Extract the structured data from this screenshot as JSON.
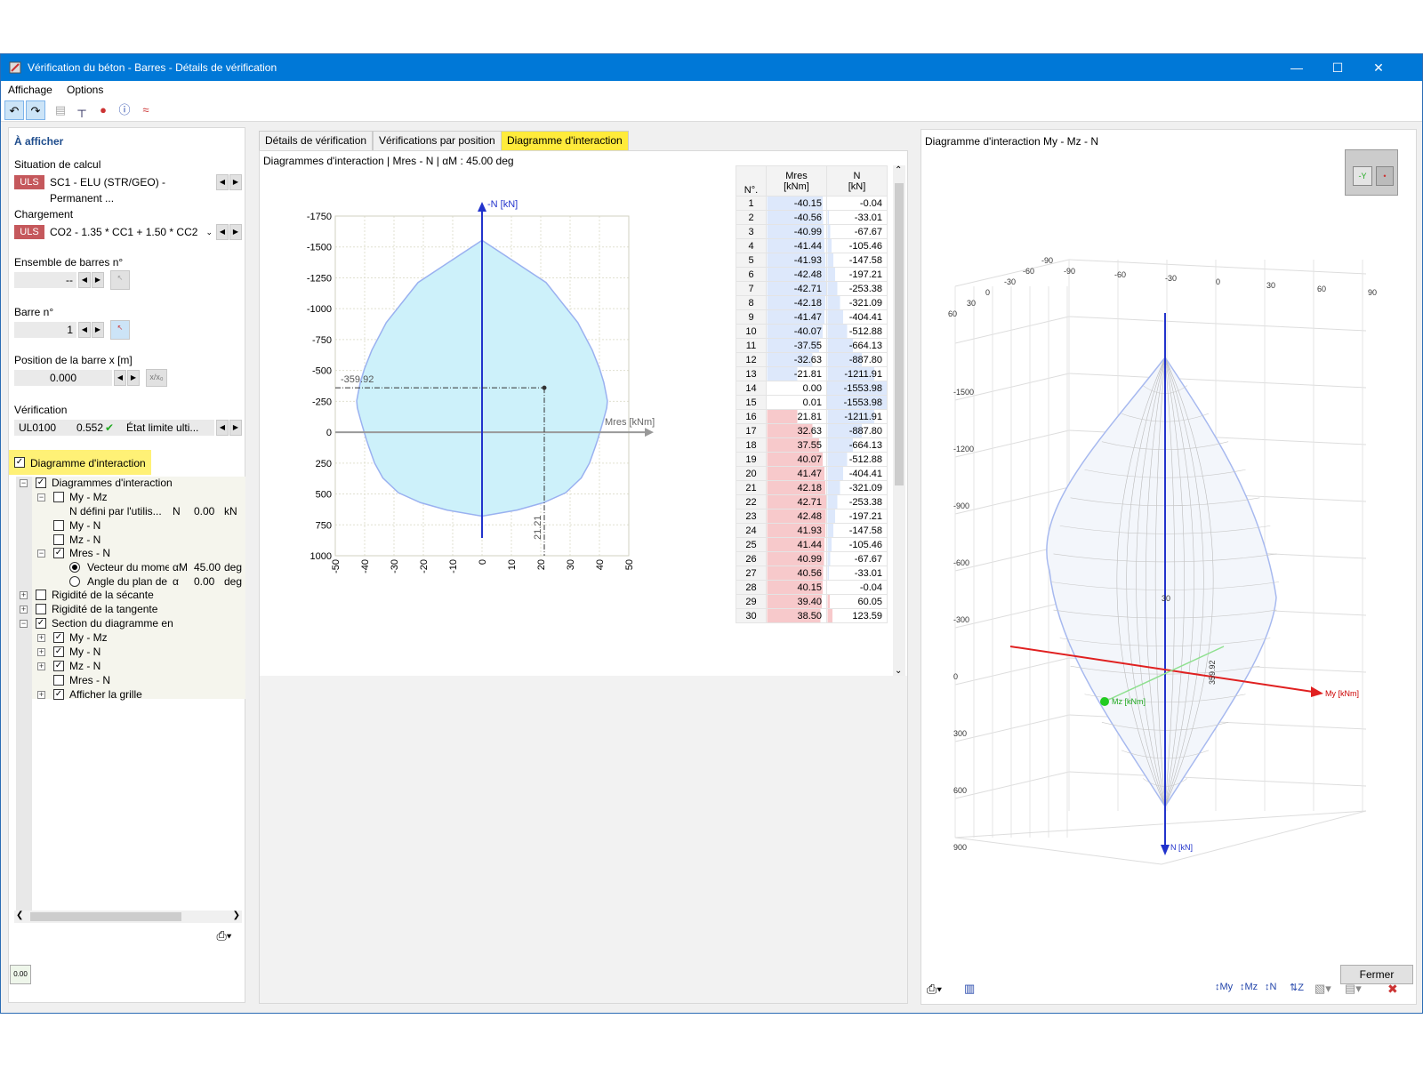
{
  "window": {
    "title": "Vérification du béton - Barres - Détails de vérification",
    "close_label": "Fermer"
  },
  "menu": [
    "Affichage",
    "Options"
  ],
  "left": {
    "header": "À afficher",
    "situation_label": "Situation de calcul",
    "situation_badge": "ULS",
    "situation_value": "SC1 - ELU (STR/GEO) - Permanent ...",
    "chargement_label": "Chargement",
    "chargement_badge": "ULS",
    "chargement_value": "CO2 - 1.35 * CC1 + 1.50 * CC2",
    "ensemble_label": "Ensemble de barres n°",
    "ensemble_value": "--",
    "barre_label": "Barre n°",
    "barre_value": "1",
    "position_label": "Position de la barre x [m]",
    "position_value": "0.000",
    "xx0": "x/x₀",
    "verif_label": "Vérification",
    "verif_code": "UL0100",
    "verif_ratio": "0.552",
    "verif_type": "État limite ulti...",
    "diag_checkbox": "Diagramme d'interaction",
    "tree": {
      "diagrammes": "Diagrammes d'interaction",
      "my_mz": "My - Mz",
      "n_defini": "N défini par l'utilis...",
      "n_sym": "N",
      "n_val": "0.00",
      "n_unit": "kN",
      "my_n": "My - N",
      "mz_n": "Mz - N",
      "mres_n": "Mres - N",
      "vecteur": "Vecteur du momer",
      "vecteur_sym": "αM",
      "vecteur_val": "45.00",
      "vecteur_unit": "deg",
      "angle": "Angle du plan de",
      "angle_sym": "α",
      "angle_val": "0.00",
      "angle_unit": "deg",
      "secante": "Rigidité de la sécante",
      "tangente": "Rigidité de la tangente",
      "section": "Section du diagramme en",
      "s_my_mz": "My - Mz",
      "s_my_n": "My - N",
      "s_mz_n": "Mz - N",
      "s_mres_n": "Mres - N",
      "grille": "Afficher la grille"
    }
  },
  "tabs": [
    "Détails de vérification",
    "Vérifications par position",
    "Diagramme d'interaction"
  ],
  "middle": {
    "subtitle": "Diagrammes d'interaction | Mres - N | αM : 45.00 deg",
    "y_axis_label": "-N [kN]",
    "x_axis_label": "Mres [kNm]",
    "annot_n": "-359.92",
    "annot_m": "21.21"
  },
  "table": {
    "head_no": "N°.",
    "head_m": "Mres",
    "head_m_unit": "[kNm]",
    "head_n": "N",
    "head_n_unit": "[kN]",
    "rows": [
      [
        "1",
        "-40.15",
        "-0.04"
      ],
      [
        "2",
        "-40.56",
        "-33.01"
      ],
      [
        "3",
        "-40.99",
        "-67.67"
      ],
      [
        "4",
        "-41.44",
        "-105.46"
      ],
      [
        "5",
        "-41.93",
        "-147.58"
      ],
      [
        "6",
        "-42.48",
        "-197.21"
      ],
      [
        "7",
        "-42.71",
        "-253.38"
      ],
      [
        "8",
        "-42.18",
        "-321.09"
      ],
      [
        "9",
        "-41.47",
        "-404.41"
      ],
      [
        "10",
        "-40.07",
        "-512.88"
      ],
      [
        "11",
        "-37.55",
        "-664.13"
      ],
      [
        "12",
        "-32.63",
        "-887.80"
      ],
      [
        "13",
        "-21.81",
        "-1211.91"
      ],
      [
        "14",
        "0.00",
        "-1553.98"
      ],
      [
        "15",
        "0.01",
        "-1553.98"
      ],
      [
        "16",
        "21.81",
        "-1211.91"
      ],
      [
        "17",
        "32.63",
        "-887.80"
      ],
      [
        "18",
        "37.55",
        "-664.13"
      ],
      [
        "19",
        "40.07",
        "-512.88"
      ],
      [
        "20",
        "41.47",
        "-404.41"
      ],
      [
        "21",
        "42.18",
        "-321.09"
      ],
      [
        "22",
        "42.71",
        "-253.38"
      ],
      [
        "23",
        "42.48",
        "-197.21"
      ],
      [
        "24",
        "41.93",
        "-147.58"
      ],
      [
        "25",
        "41.44",
        "-105.46"
      ],
      [
        "26",
        "40.99",
        "-67.67"
      ],
      [
        "27",
        "40.56",
        "-33.01"
      ],
      [
        "28",
        "40.15",
        "-0.04"
      ],
      [
        "29",
        "39.40",
        "60.05"
      ],
      [
        "30",
        "38.50",
        "123.59"
      ]
    ]
  },
  "chart_data": {
    "type": "area",
    "title": "Diagrammes d'interaction | Mres - N | αM : 45.00 deg",
    "xlabel": "Mres [kNm]",
    "ylabel": "-N [kN]",
    "xlim": [
      -50,
      50
    ],
    "ylim": [
      -1750,
      1000
    ],
    "x_ticks": [
      -50,
      -40,
      -30,
      -20,
      -10,
      0,
      10,
      20,
      30,
      40,
      50
    ],
    "y_ticks": [
      -1750,
      -1500,
      -1250,
      -1000,
      -750,
      -500,
      -250,
      0,
      250,
      500,
      750,
      1000
    ],
    "y_reversed": true,
    "grid": true,
    "series": [
      {
        "x": [
          0,
          21.81,
          32.63,
          37.55,
          40.07,
          41.47,
          42.18,
          42.71,
          42.48,
          41.93,
          41.44,
          40.99,
          40.56,
          40.15,
          39.4,
          38.5,
          36.6,
          33.8,
          28.5,
          21,
          12,
          0,
          -12,
          -21,
          -28.5,
          -33.8,
          -36.6,
          -38.5,
          -39.4,
          -40.15,
          -40.56,
          -40.99,
          -41.44,
          -41.93,
          -42.48,
          -42.71,
          -42.18,
          -41.47,
          -40.07,
          -37.55,
          -32.63,
          -21.81
        ],
        "y": [
          -1553.98,
          -1211.91,
          -887.8,
          -664.13,
          -512.88,
          -404.41,
          -321.09,
          -253.38,
          -197.21,
          -147.58,
          -105.46,
          -67.67,
          -33.01,
          -0.04,
          60.05,
          123.59,
          250,
          370,
          490,
          570,
          630,
          680,
          630,
          570,
          490,
          370,
          250,
          123.59,
          60.05,
          -0.04,
          -33.01,
          -67.67,
          -105.46,
          -147.58,
          -197.21,
          -253.38,
          -321.09,
          -404.41,
          -512.88,
          -664.13,
          -887.8,
          -1211.91
        ]
      }
    ],
    "annotation": {
      "x": 21.21,
      "y": -359.92
    }
  },
  "right": {
    "title": "Diagramme d'interaction My - Mz - N",
    "axis_my": "My [kNm]",
    "axis_mz": "Mz [kNm]",
    "axis_n": "N [kN]",
    "top_ticks_a": [
      "-90",
      "-60",
      "-30",
      "0",
      "30",
      "60",
      "90"
    ],
    "top_ticks_b": [
      "60",
      "30",
      "0",
      "-30",
      "-60",
      "-90"
    ],
    "left_ticks": [
      "-1500",
      "-1200",
      "-900",
      "-600",
      "-300",
      "0",
      "300",
      "600",
      "900"
    ],
    "mid_labels": [
      "30",
      "359.92"
    ]
  }
}
